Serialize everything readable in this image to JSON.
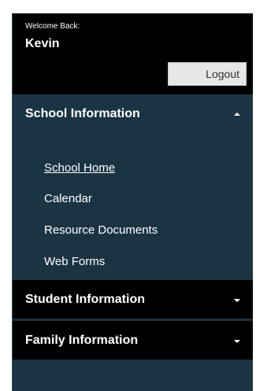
{
  "welcome": {
    "greeting": "Welcome Back:",
    "name": "Kevin",
    "logout_label": "Logout"
  },
  "sections": {
    "school": {
      "label": "School Information",
      "expanded": true,
      "items": [
        {
          "label": "School Home",
          "active": true
        },
        {
          "label": "Calendar",
          "active": false
        },
        {
          "label": "Resource Documents",
          "active": false
        },
        {
          "label": "Web Forms",
          "active": false
        }
      ]
    },
    "student": {
      "label": "Student Information",
      "expanded": false
    },
    "family": {
      "label": "Family Information",
      "expanded": false
    }
  },
  "colors": {
    "panel_bg": "#1b3443",
    "header_bg": "#000000",
    "text": "#ffffff",
    "button_bg": "#e6e6e6"
  }
}
